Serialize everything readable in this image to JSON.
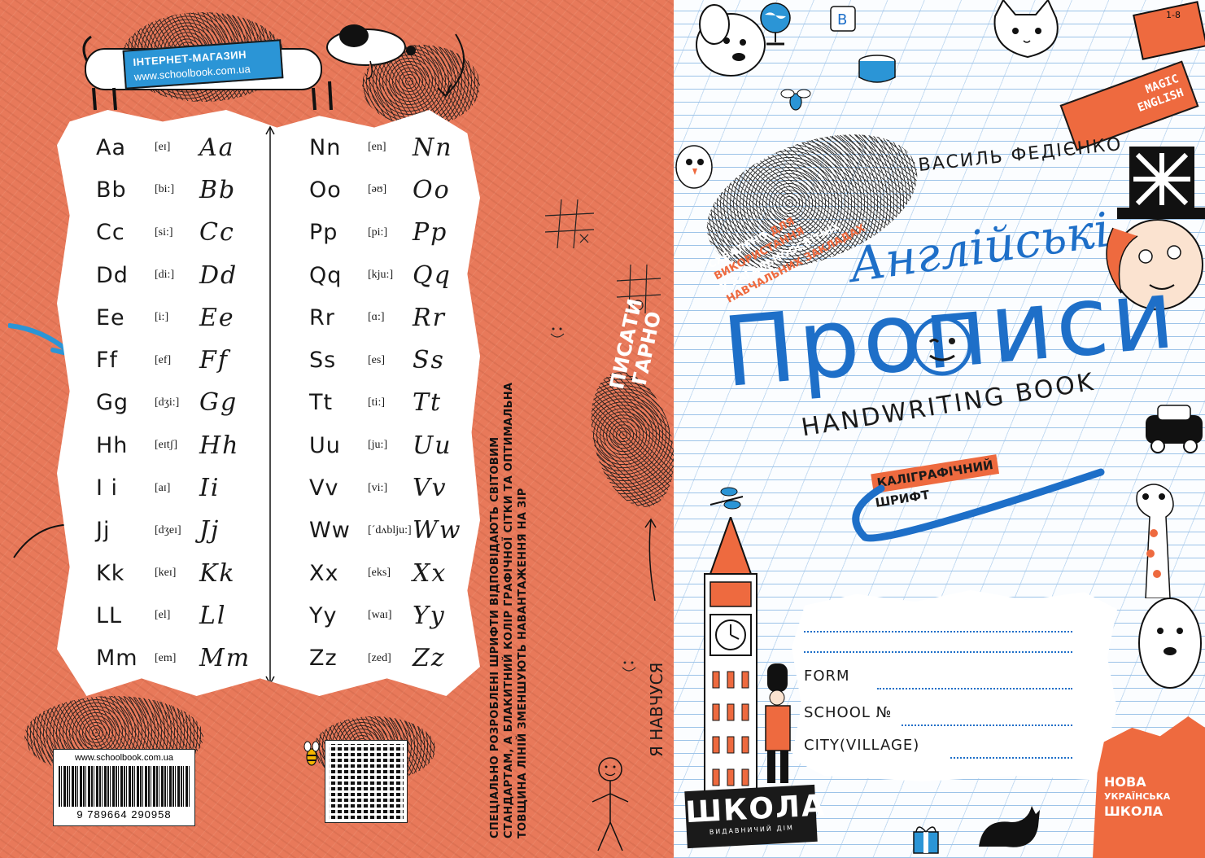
{
  "back_cover": {
    "shop_badge": {
      "line1": "ІНТЕРНЕТ-МАГАЗИН",
      "line2": "www.schoolbook.com.ua"
    },
    "alphabet_left": [
      {
        "letter": "Aa",
        "phonetic": "[eɪ]",
        "cursive": "Aa"
      },
      {
        "letter": "Bb",
        "phonetic": "[bi:]",
        "cursive": "Bb"
      },
      {
        "letter": "Cc",
        "phonetic": "[si:]",
        "cursive": "Cc"
      },
      {
        "letter": "Dd",
        "phonetic": "[di:]",
        "cursive": "Dd"
      },
      {
        "letter": "Ee",
        "phonetic": "[i:]",
        "cursive": "Ee"
      },
      {
        "letter": "Ff",
        "phonetic": "[ef]",
        "cursive": "Ff"
      },
      {
        "letter": "Gg",
        "phonetic": "[dʒi:]",
        "cursive": "Gg"
      },
      {
        "letter": "Hh",
        "phonetic": "[eɪtʃ]",
        "cursive": "Hh"
      },
      {
        "letter": "I i",
        "phonetic": "[aɪ]",
        "cursive": "Ii"
      },
      {
        "letter": "Jj",
        "phonetic": "[dʒeɪ]",
        "cursive": "Jj"
      },
      {
        "letter": "Kk",
        "phonetic": "[keɪ]",
        "cursive": "Kk"
      },
      {
        "letter": "LL",
        "phonetic": "[el]",
        "cursive": "Ll"
      },
      {
        "letter": "Mm",
        "phonetic": "[em]",
        "cursive": "Mm"
      }
    ],
    "alphabet_right": [
      {
        "letter": "Nn",
        "phonetic": "[en]",
        "cursive": "Nn"
      },
      {
        "letter": "Oo",
        "phonetic": "[əʊ]",
        "cursive": "Oo"
      },
      {
        "letter": "Pp",
        "phonetic": "[pi:]",
        "cursive": "Pp"
      },
      {
        "letter": "Qq",
        "phonetic": "[kju:]",
        "cursive": "Qq"
      },
      {
        "letter": "Rr",
        "phonetic": "[ɑ:]",
        "cursive": "Rr"
      },
      {
        "letter": "Ss",
        "phonetic": "[es]",
        "cursive": "Ss"
      },
      {
        "letter": "Tt",
        "phonetic": "[ti:]",
        "cursive": "Tt"
      },
      {
        "letter": "Uu",
        "phonetic": "[ju:]",
        "cursive": "Uu"
      },
      {
        "letter": "Vv",
        "phonetic": "[vi:]",
        "cursive": "Vv"
      },
      {
        "letter": "Ww",
        "phonetic": "[ˊdʌblju:]",
        "cursive": "Ww"
      },
      {
        "letter": "Xx",
        "phonetic": "[eks]",
        "cursive": "Xx"
      },
      {
        "letter": "Yy",
        "phonetic": "[waɪ]",
        "cursive": "Yy"
      },
      {
        "letter": "Zz",
        "phonetic": "[zed]",
        "cursive": "Zz"
      }
    ],
    "barcode": {
      "url": "www.schoolbook.com.ua",
      "number": "9 789664 290958"
    },
    "spine_text": {
      "line1": "СПЕЦІАЛЬНО РОЗРОБЛЕНІ ШРИФТИ ВІДПОВІДАЮТЬ СВІТОВИМ",
      "line2": "СТАНДАРТАМ, А БЛАКИТНИЙ КОЛІР ГРАФІЧНОЇ СІТКИ ТА ОПТИМАЛЬНА",
      "line3": "ТОВЩИНА ЛІНІЙ ЗМЕНШУЮТЬ НАВАНТАЖЕННЯ НА ЗІР"
    },
    "scribble_text": {
      "line1": "ПИСАТИ",
      "line2": "ГАРНО"
    },
    "handwritten": "Я НАВЧУСЯ"
  },
  "front_cover": {
    "magic_banner": {
      "line1": "MAGIC",
      "line2": "ENGLISH"
    },
    "author": "ВАСИЛЬ ФЕДІЄНКО",
    "approved": {
      "line1_a": "СХВАЛЕНО",
      "line1_b": "ДЛЯ",
      "line2": "ВИКОРИСТАННЯ",
      "line3": "У ЗАГАЛЬНООСВІТНІХ",
      "line4": "НАВЧАЛЬНИХ ЗАКЛАДАХ"
    },
    "title_small": "Англійські",
    "title_big": "Прописи",
    "subtitle": "HANDWRITING BOOK",
    "font_label": {
      "line1": "КАЛІГРАФІЧНИЙ",
      "line2": "ШРИФТ"
    },
    "form_fields": [
      "FORM",
      "SCHOOL №",
      "CITY(VILLAGE)"
    ],
    "publisher": {
      "name": "ШКОЛА",
      "sub": "ВИДАВНИЧИЙ ДІМ"
    },
    "nush": {
      "line1": "НОВА",
      "line2": "УКРАЇНСЬКА",
      "line3": "ШКОЛА"
    },
    "colors": {
      "blue": "#1e6fc8",
      "orange": "#ee6a3f",
      "back_orange": "#e8795a"
    }
  }
}
